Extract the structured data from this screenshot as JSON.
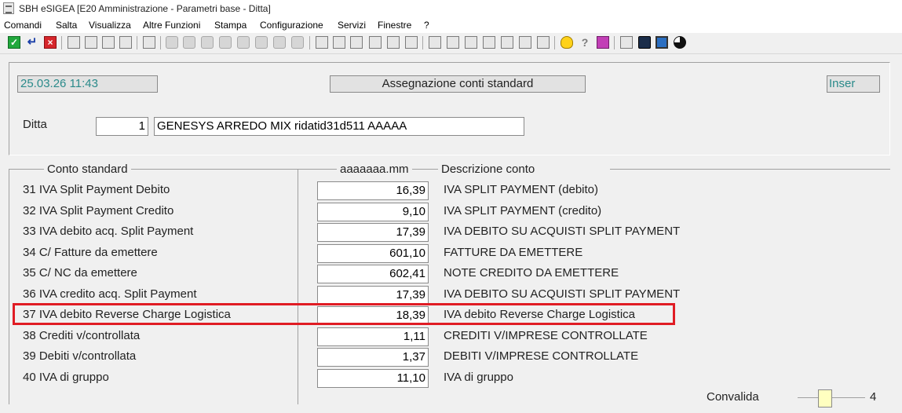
{
  "window": {
    "title": "SBH eSIGEA [E20 Amministrazione - Parametri base - Ditta]"
  },
  "menu": [
    "Comandi",
    "Salta",
    "Visualizza",
    "Altre Funzioni",
    "Stampa",
    "Configurazione",
    "Servizi",
    "Finestre",
    "?"
  ],
  "toolbar": {
    "icons": [
      "confirm-check",
      "enter-arrow",
      "cancel-x",
      "yellow-window",
      "yellow-window",
      "note-edit",
      "note-list",
      "window-tool",
      "f1-key",
      "f2-key",
      "f3-key",
      "f4-key",
      "f5-key",
      "binoculars",
      "f9-key",
      "pencil-tool",
      "printer",
      "print-preview",
      "grid-view",
      "export",
      "document",
      "ruler",
      "layout",
      "sparkle",
      "table",
      "table",
      "calendar",
      "calendar",
      "bulb",
      "help",
      "book",
      "calculator",
      "phone",
      "monitor",
      "pie-chart"
    ]
  },
  "header": {
    "datetime": "25.03.26 11:43",
    "title": "Assegnazione conti standard",
    "mode": "Inser"
  },
  "ditta": {
    "label": "Ditta",
    "code": "1",
    "name": "GENESYS ARREDO MIX ridatid31d511 AAAAA"
  },
  "columns": {
    "conto": "Conto standard",
    "value": "aaaaaaa.mm",
    "desc": "Descrizione conto"
  },
  "rows": [
    {
      "name": "31 IVA Split Payment Debito",
      "value": "16,39",
      "desc": "IVA SPLIT PAYMENT (debito)"
    },
    {
      "name": "32 IVA Split Payment Credito",
      "value": "9,10",
      "desc": "IVA SPLIT PAYMENT (credito)"
    },
    {
      "name": "33 IVA debito acq. Split Payment",
      "value": "17,39",
      "desc": "IVA DEBITO SU ACQUISTI SPLIT PAYMENT"
    },
    {
      "name": "34 C/ Fatture da emettere",
      "value": "601,10",
      "desc": "FATTURE DA EMETTERE"
    },
    {
      "name": "35 C/ NC da emettere",
      "value": "602,41",
      "desc": "NOTE CREDITO DA EMETTERE"
    },
    {
      "name": "36 IVA credito acq. Split Payment",
      "value": "17,39",
      "desc": "IVA DEBITO SU ACQUISTI SPLIT PAYMENT"
    },
    {
      "name": "37 IVA debito Reverse Charge Logistica",
      "value": "18,39",
      "desc": "IVA debito Reverse Charge Logistica"
    },
    {
      "name": "38 Crediti v/controllata",
      "value": "1,11",
      "desc": "CREDITI V/IMPRESE CONTROLLATE"
    },
    {
      "name": "39 Debiti  v/controllata",
      "value": "1,37",
      "desc": "DEBITI V/IMPRESE CONTROLLATE"
    },
    {
      "name": "40 IVA di gruppo",
      "value": "11,10",
      "desc": "IVA di gruppo"
    }
  ],
  "footer": {
    "label": "Convalida",
    "page": "4"
  },
  "colors": {
    "highlight": "#e01c24",
    "teal_text": "#2a8a8a",
    "inactive_box": "#ffffc0"
  }
}
